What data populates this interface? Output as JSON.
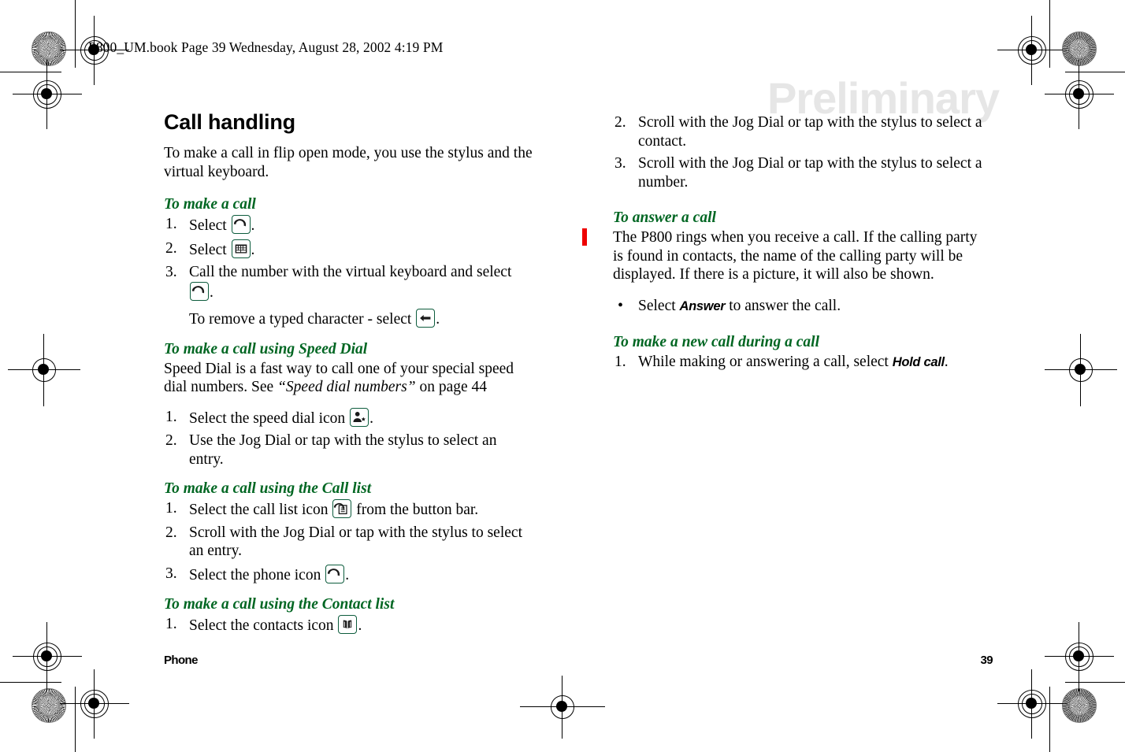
{
  "header": {
    "slug": "P800_UM.book  Page 39  Wednesday, August 28, 2002  4:19 PM"
  },
  "watermark": {
    "text": "Preliminary",
    "color": "#e6e6e6"
  },
  "colors": {
    "heading_green": "#006622",
    "change_bar_red": "#ee0000",
    "icon_border": "#0d5c3d"
  },
  "left_column": {
    "chapter_title": "Call handling",
    "intro": "To make a call in flip open mode, you use the stylus and the virtual keyboard.",
    "sections": [
      {
        "subhead": "To make a call",
        "steps": [
          {
            "num": "1.",
            "before": "Select ",
            "icon": "phone-handset-icon",
            "after": "."
          },
          {
            "num": "2.",
            "before": "Select ",
            "icon": "virtual-keyboard-icon",
            "after": "."
          },
          {
            "num": "3.",
            "before": "Call the number with the virtual keyboard and select ",
            "icon": "phone-handset-icon",
            "after": "."
          }
        ],
        "note_before": "To remove a typed character - select ",
        "note_icon": "backspace-arrow-icon",
        "note_after": "."
      },
      {
        "subhead": "To make a call using Speed Dial",
        "paragraph_pre": "Speed Dial is a fast way to call one of your special speed dial numbers. See ",
        "paragraph_italic": "“Speed dial numbers”",
        "paragraph_post": " on page 44",
        "steps": [
          {
            "num": "1.",
            "before": "Select the speed dial icon ",
            "icon": "speed-dial-icon",
            "after": "."
          },
          {
            "num": "2.",
            "before": "Use the Jog Dial or tap with the stylus to select an entry.",
            "icon": "",
            "after": ""
          }
        ]
      },
      {
        "subhead": "To make a call using the Call list",
        "steps": [
          {
            "num": "1.",
            "before": "Select the call list icon ",
            "icon": "call-list-icon",
            "after": " from the button bar."
          },
          {
            "num": "2.",
            "before": "Scroll with the Jog Dial or tap with the stylus to select an entry.",
            "icon": "",
            "after": ""
          },
          {
            "num": "3.",
            "before": "Select the phone icon ",
            "icon": "phone-handset-icon",
            "after": "."
          }
        ]
      },
      {
        "subhead": "To make a call using the Contact list",
        "steps": [
          {
            "num": "1.",
            "before": "Select the contacts icon ",
            "icon": "contacts-book-icon",
            "after": "."
          }
        ]
      }
    ]
  },
  "right_column": {
    "continued_steps": [
      {
        "num": "2.",
        "text": "Scroll with the Jog Dial or tap with the stylus to select a contact."
      },
      {
        "num": "3.",
        "text": "Scroll with the Jog Dial or tap with the stylus to select a number."
      }
    ],
    "sections": [
      {
        "subhead": "To answer a call",
        "paragraph": "The P800 rings when you receive a call. If the calling party is found in contacts, the name of the calling party will be displayed. If there is a picture, it will also be shown.",
        "has_change_bar": true,
        "bullets": [
          {
            "marker": "•",
            "before": "Select ",
            "ui": "Answer",
            "after": " to answer the call."
          }
        ]
      },
      {
        "subhead": "To make a new call during a call",
        "steps": [
          {
            "num": "1.",
            "before": "While making or answering a call, select ",
            "ui": "Hold call",
            "after": "."
          }
        ]
      }
    ]
  },
  "footer": {
    "left": "Phone",
    "right": "39"
  }
}
